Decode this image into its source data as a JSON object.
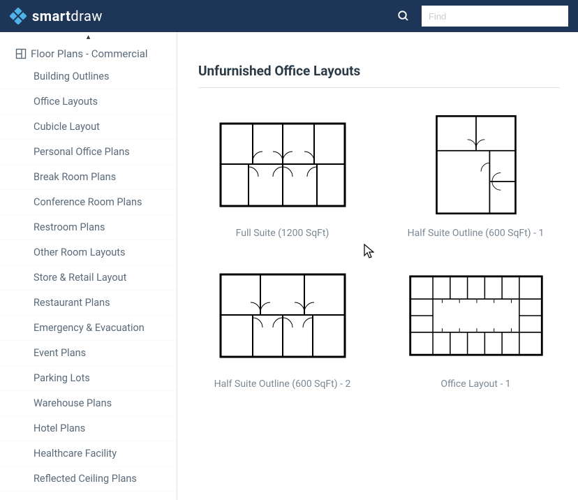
{
  "header": {
    "brand_prefix": "smart",
    "brand_suffix": "draw",
    "search_placeholder": "Find"
  },
  "sidebar": {
    "category_label": "Floor Plans - Commercial",
    "items": [
      "Building Outlines",
      "Office Layouts",
      "Cubicle Layout",
      "Personal Office Plans",
      "Break Room Plans",
      "Conference Room Plans",
      "Restroom Plans",
      "Other Room Layouts",
      "Store & Retail Layout",
      "Restaurant Plans",
      "Emergency & Evacuation",
      "Event Plans",
      "Parking Lots",
      "Warehouse Plans",
      "Hotel Plans",
      "Healthcare Facility",
      "Reflected Ceiling Plans"
    ]
  },
  "main": {
    "title": "Unfurnished Office Layouts",
    "cards": [
      {
        "label": "Full Suite (1200 SqFt)"
      },
      {
        "label": "Half Suite Outline (600 SqFt) - 1"
      },
      {
        "label": "Half Suite Outline (600 SqFt) - 2"
      },
      {
        "label": "Office Layout - 1"
      }
    ]
  }
}
